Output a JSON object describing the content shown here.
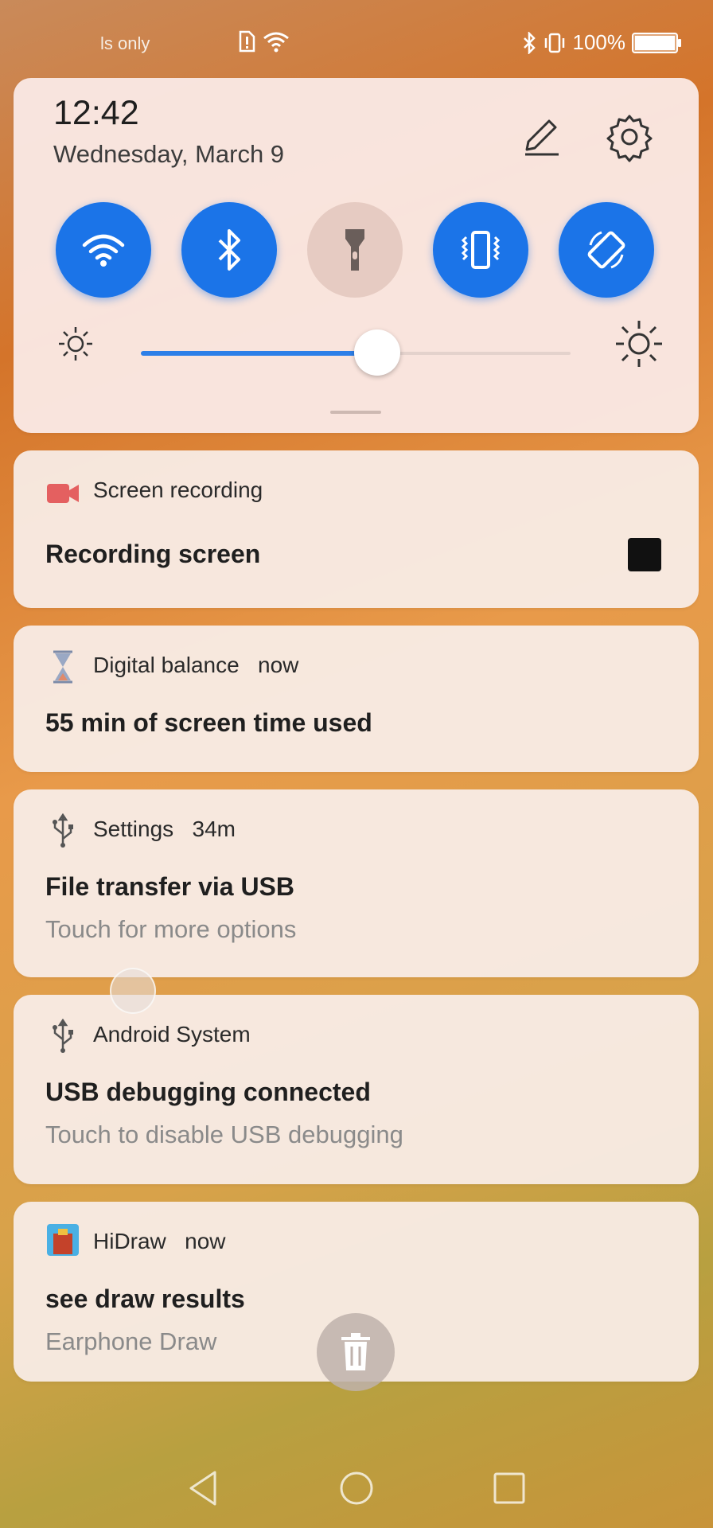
{
  "status_bar": {
    "carrier": "ls only",
    "battery_text": "100%"
  },
  "quick_settings": {
    "time": "12:42",
    "date": "Wednesday, March 9",
    "toggles": [
      {
        "name": "wifi-toggle",
        "icon": "wifi-icon",
        "active": true
      },
      {
        "name": "bluetooth-toggle",
        "icon": "bluetooth-icon",
        "active": true
      },
      {
        "name": "flashlight-toggle",
        "icon": "flashlight-icon",
        "active": false
      },
      {
        "name": "vibrate-toggle",
        "icon": "vibrate-icon",
        "active": true
      },
      {
        "name": "auto-rotate-toggle",
        "icon": "rotate-icon",
        "active": true
      }
    ],
    "brightness_level": 0.55
  },
  "notifications": [
    {
      "app": "Screen recording",
      "time": "",
      "title": "Recording screen",
      "text": "",
      "icon": "screen-record-icon"
    },
    {
      "app": "Digital balance",
      "time": "now",
      "title": "55 min of screen time used",
      "text": "",
      "icon": "hourglass-icon"
    },
    {
      "app": "Settings",
      "time": "34m",
      "title": "File transfer via USB",
      "text": "Touch for more options",
      "icon": "usb-icon"
    },
    {
      "app": "Android System",
      "time": "",
      "title": "USB debugging connected",
      "text": "Touch to disable USB debugging",
      "icon": "usb-icon"
    },
    {
      "app": "HiDraw",
      "time": "now",
      "title": "see draw results",
      "text": "Earphone Draw",
      "icon": "hidraw-app-icon"
    }
  ],
  "colors": {
    "accent": "#1b74e8",
    "record_red": "#e46060"
  }
}
